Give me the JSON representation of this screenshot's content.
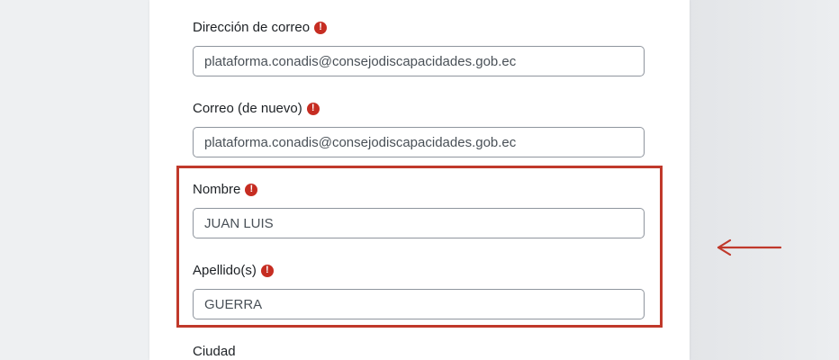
{
  "form": {
    "email": {
      "label": "Dirección de correo",
      "value": "plataforma.conadis@consejodiscapacidades.gob.ec",
      "required_icon": "exclamation-circle-icon"
    },
    "email_confirm": {
      "label": "Correo (de nuevo)",
      "value": "plataforma.conadis@consejodiscapacidades.gob.ec",
      "required_icon": "exclamation-circle-icon"
    },
    "first_name": {
      "label": "Nombre",
      "value": "JUAN LUIS",
      "required_icon": "exclamation-circle-icon"
    },
    "last_name": {
      "label": "Apellido(s)",
      "value": "GUERRA",
      "required_icon": "exclamation-circle-icon"
    },
    "city": {
      "label": "Ciudad"
    },
    "required_glyph": "!"
  },
  "annotation": {
    "highlight_color": "#c0392b",
    "arrow_icon": "left-arrow-icon"
  },
  "colors": {
    "required": "#c62d22",
    "input_border": "#8f959e",
    "text": "#1d2125",
    "input_text": "#495057"
  }
}
